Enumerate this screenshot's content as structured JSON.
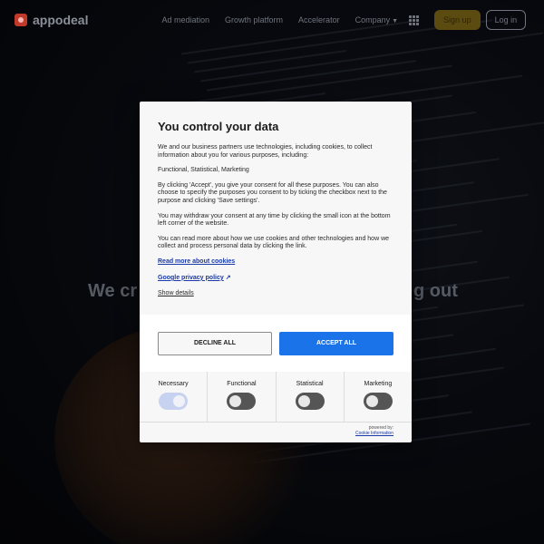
{
  "header": {
    "logo_text": "appodeal",
    "nav": [
      {
        "label": "Ad mediation"
      },
      {
        "label": "Growth platform"
      },
      {
        "label": "Accelerator"
      },
      {
        "label": "Company"
      }
    ],
    "signup_label": "Sign up",
    "login_label": "Log in"
  },
  "hero": {
    "left_text": "We cr",
    "right_text": "g out"
  },
  "modal": {
    "title": "You control your data",
    "paragraphs": [
      "We and our business partners use technologies, including cookies, to collect information about you for various purposes, including:",
      "Functional, Statistical, Marketing",
      "By clicking 'Accept', you give your consent for all these purposes. You can also choose to specify the purposes you consent to by ticking the checkbox next to the purpose and clicking 'Save settings'.",
      "You may withdraw your consent at any time by clicking the small icon at the bottom left corner of the website.",
      "You can read more about how we use cookies and other technologies and how we collect and process personal data by clicking the link."
    ],
    "read_more_label": "Read more about cookies",
    "google_policy_label": "Google privacy policy",
    "show_details_label": "Show details",
    "decline_label": "DECLINE ALL",
    "accept_label": "ACCEPT ALL",
    "toggles": [
      {
        "label": "Necessary",
        "on": true
      },
      {
        "label": "Functional",
        "on": false
      },
      {
        "label": "Statistical",
        "on": false
      },
      {
        "label": "Marketing",
        "on": false
      }
    ],
    "powered_by": "powered by:",
    "powered_link": "Cookie Information"
  },
  "colors": {
    "accept": "#1a73e8",
    "signup": "#5c4b10",
    "logo": "#c0392b"
  }
}
